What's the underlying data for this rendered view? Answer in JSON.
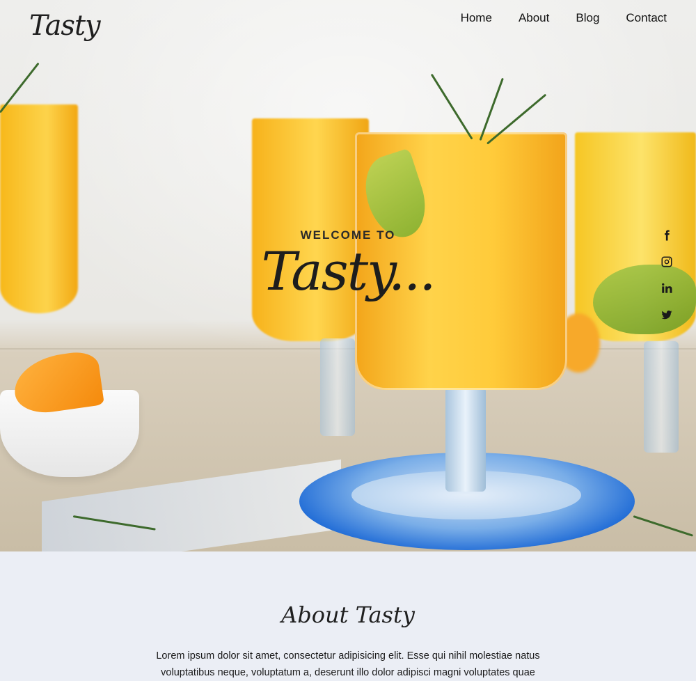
{
  "header": {
    "logo": "Tasty",
    "nav": [
      "Home",
      "About",
      "Blog",
      "Contact"
    ]
  },
  "hero": {
    "welcome_label": "WELCOME TO",
    "title": "Tasty...",
    "social": [
      "facebook-icon",
      "instagram-icon",
      "linkedin-icon",
      "twitter-icon"
    ]
  },
  "about": {
    "title": "About Tasty",
    "text": "Lorem ipsum dolor sit amet, consectetur adipisicing elit. Esse qui nihil molestiae natus voluptatibus neque, voluptatum a, deserunt illo dolor adipisci magni voluptates quae"
  },
  "colors": {
    "accent_juice": "#ffd34a",
    "coaster_blue": "#1f6bd6",
    "section_bg": "#ebeef5"
  }
}
